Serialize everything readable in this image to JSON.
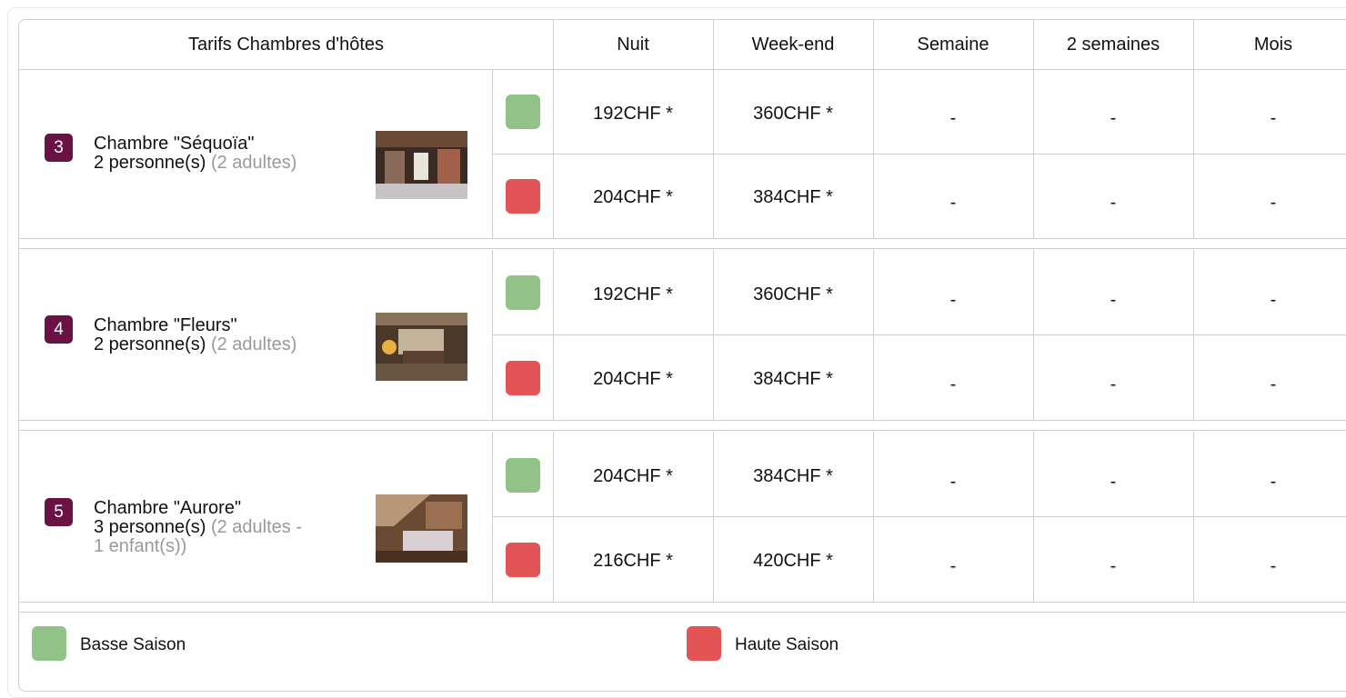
{
  "header": {
    "title": "Tarifs Chambres d'hôtes",
    "col_night": "Nuit",
    "col_weekend": "Week-end",
    "col_week": "Semaine",
    "col_two_weeks": "2 semaines",
    "col_month": "Mois"
  },
  "rooms": [
    {
      "number": "3",
      "name": "Chambre \"Séquoïa\"",
      "persons": "2 personne(s)",
      "persons_detail": "(2 adultes)",
      "low": {
        "night": "192CHF *",
        "weekend": "360CHF *",
        "week": "-",
        "two_weeks": "-",
        "month": "-"
      },
      "high": {
        "night": "204CHF *",
        "weekend": "384CHF *",
        "week": "-",
        "two_weeks": "-",
        "month": "-"
      }
    },
    {
      "number": "4",
      "name": "Chambre \"Fleurs\"",
      "persons": "2 personne(s)",
      "persons_detail": "(2 adultes)",
      "low": {
        "night": "192CHF *",
        "weekend": "360CHF *",
        "week": "-",
        "two_weeks": "-",
        "month": "-"
      },
      "high": {
        "night": "204CHF *",
        "weekend": "384CHF *",
        "week": "-",
        "two_weeks": "-",
        "month": "-"
      }
    },
    {
      "number": "5",
      "name": "Chambre \"Aurore\"",
      "persons": "3 personne(s)",
      "persons_detail": "(2 adultes -",
      "persons_detail2": "1 enfant(s))",
      "low": {
        "night": "204CHF *",
        "weekend": "384CHF *",
        "week": "-",
        "two_weeks": "-",
        "month": "-"
      },
      "high": {
        "night": "216CHF *",
        "weekend": "420CHF *",
        "week": "-",
        "two_weeks": "-",
        "month": "-"
      }
    }
  ],
  "legend": {
    "low_label": "Basse Saison",
    "high_label": "Haute Saison"
  },
  "colors": {
    "low_season": "#91c287",
    "high_season": "#e25455",
    "badge": "#6b1245"
  }
}
